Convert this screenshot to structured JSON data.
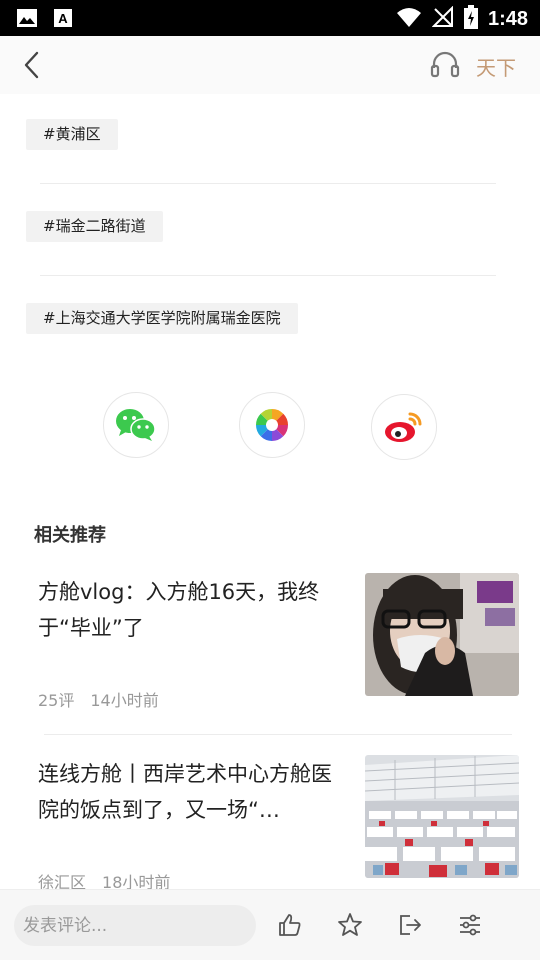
{
  "status_bar": {
    "time": "1:48",
    "icons": [
      "image-icon",
      "a-notification-icon",
      "wifi-icon",
      "no-signal-icon",
      "battery-charging-icon"
    ]
  },
  "header": {
    "back_icon": "chevron-left-icon",
    "audio_icon": "headphones-icon",
    "channel_label": "天下"
  },
  "tags": [
    {
      "label": "#黄浦区"
    },
    {
      "label": "#瑞金二路街道"
    },
    {
      "label": "#上海交通大学医学院附属瑞金医院"
    }
  ],
  "share": {
    "buttons": [
      {
        "name": "wechat",
        "icon": "wechat-icon"
      },
      {
        "name": "moments",
        "icon": "moments-icon"
      },
      {
        "name": "weibo",
        "icon": "weibo-icon"
      }
    ]
  },
  "related": {
    "title": "相关推荐",
    "items": [
      {
        "title": "方舱vlog：入方舱16天，我终于“毕业”了",
        "meta1": "25评",
        "meta2": "14小时前"
      },
      {
        "title": "连线方舱丨西岸艺术中心方舱医院的饭点到了，又一场“…",
        "meta1": "徐汇区",
        "meta2": "18小时前"
      }
    ]
  },
  "bottom_bar": {
    "comment_placeholder": "发表评论...",
    "actions": [
      "like-icon",
      "favorite-icon",
      "share-icon",
      "settings-icon"
    ]
  },
  "colors": {
    "accent": "#c49a75",
    "tag_bg": "#f2f2f2",
    "meta_text": "#999999"
  }
}
